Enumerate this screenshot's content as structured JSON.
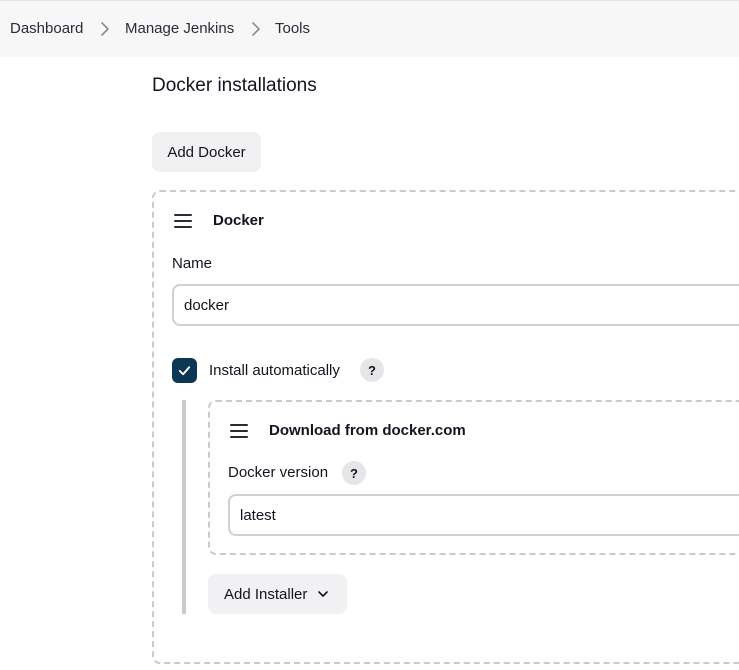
{
  "breadcrumb": {
    "items": [
      {
        "label": "Dashboard"
      },
      {
        "label": "Manage Jenkins"
      },
      {
        "label": "Tools"
      }
    ]
  },
  "section": {
    "title": "Docker installations",
    "add_button_label": "Add Docker"
  },
  "installation": {
    "title": "Docker",
    "name_label": "Name",
    "name_value": "docker",
    "install_auto_label": "Install automatically",
    "install_auto_checked": true,
    "help_symbol": "?",
    "installer": {
      "title": "Download from docker.com",
      "version_label": "Docker version",
      "version_value": "latest"
    },
    "add_installer_label": "Add Installer"
  },
  "colors": {
    "checkbox": "#0b3654",
    "breadcrumb_bg": "#f7f7f8",
    "dashed_border": "#c9c9cf"
  },
  "icons": {
    "separator": "chevron-right-icon",
    "drag": "drag-handle-icon",
    "check": "check-icon",
    "dropdown": "chevron-down-icon"
  }
}
